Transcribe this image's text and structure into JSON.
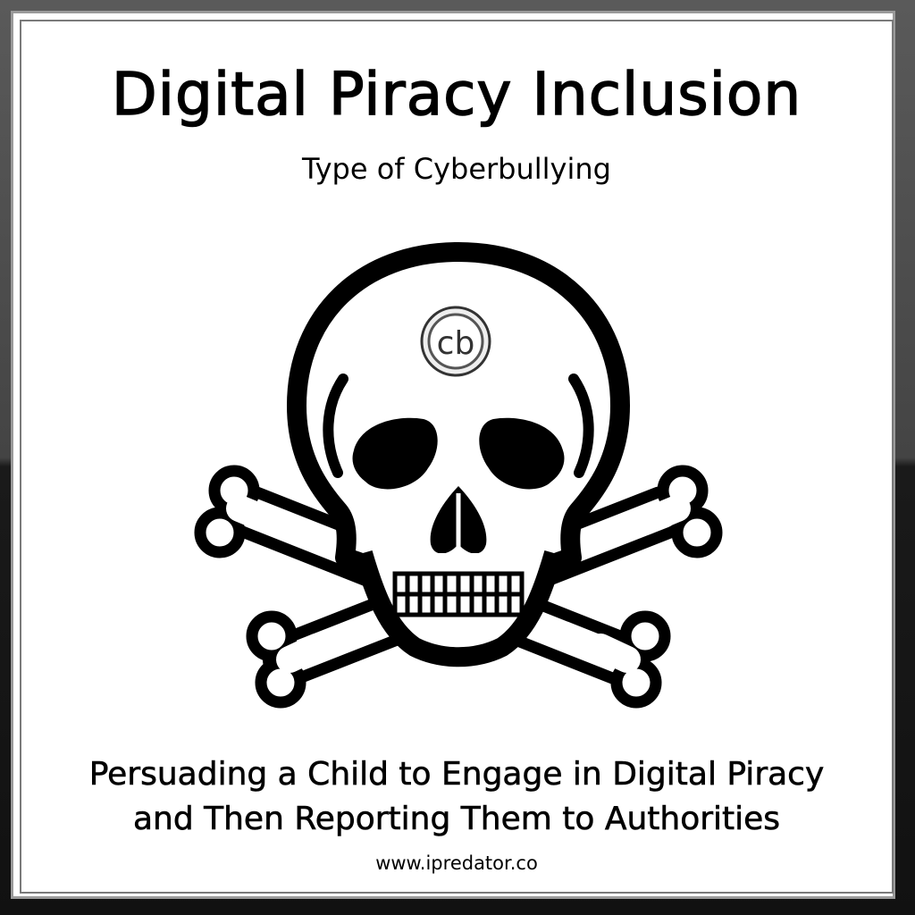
{
  "card": {
    "title": "Digital Piracy Inclusion",
    "subtitle": "Type of Cyberbullying",
    "emblem": {
      "icon": "skull-and-crossbones-icon",
      "badge_text": "cb"
    },
    "caption_line_1": "Persuading a Child to Engage in Digital Piracy",
    "caption_line_2": "and Then Reporting Them to Authorities",
    "website": "www.ipredator.co"
  },
  "colors": {
    "ink": "#000000",
    "paper": "#ffffff",
    "frame": "#7a7a7a"
  }
}
